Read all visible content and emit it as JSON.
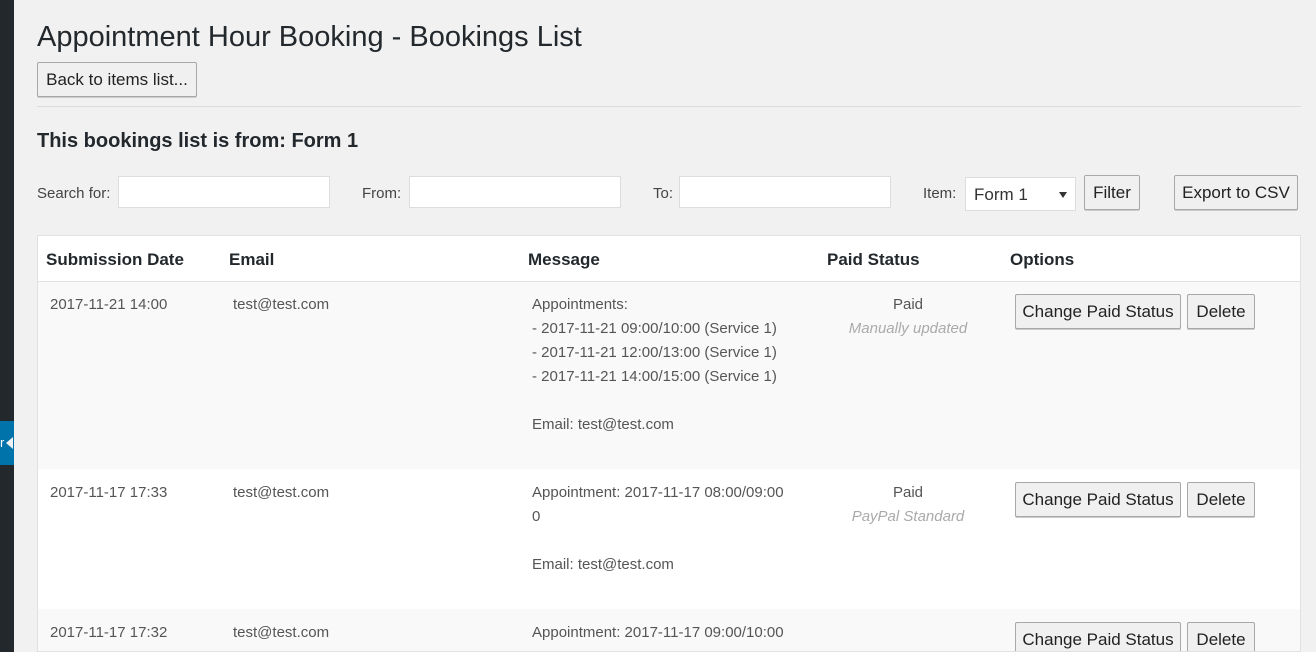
{
  "page": {
    "title": "Appointment Hour Booking - Bookings List",
    "back_label": "Back to items list...",
    "list_from": "This bookings list is from: Form 1",
    "sidebar_collapse_text": "r"
  },
  "filters": {
    "search_label": "Search for:",
    "search_value": "",
    "from_label": "From:",
    "from_value": "",
    "to_label": "To:",
    "to_value": "",
    "item_label": "Item:",
    "item_selected": "Form 1",
    "filter_label": "Filter",
    "export_label": "Export to CSV"
  },
  "table": {
    "headers": {
      "date": "Submission Date",
      "email": "Email",
      "message": "Message",
      "paid": "Paid Status",
      "options": "Options"
    },
    "rows": [
      {
        "date": "2017-11-21 14:00",
        "email": "test@test.com",
        "message": [
          "Appointments:",
          "- 2017-11-21 09:00/10:00 (Service 1)",
          "- 2017-11-21 12:00/13:00 (Service 1)",
          "- 2017-11-21 14:00/15:00 (Service 1)",
          "",
          "Email: test@test.com"
        ],
        "paid_status": "Paid",
        "paid_note": "Manually updated",
        "change_label": "Change Paid Status",
        "delete_label": "Delete"
      },
      {
        "date": "2017-11-17 17:33",
        "email": "test@test.com",
        "message": [
          "Appointment: 2017-11-17 08:00/09:00",
          "0",
          "",
          "Email: test@test.com"
        ],
        "paid_status": "Paid",
        "paid_note": "PayPal Standard",
        "change_label": "Change Paid Status",
        "delete_label": "Delete"
      },
      {
        "date": "2017-11-17 17:32",
        "email": "test@test.com",
        "message": [
          "Appointment: 2017-11-17 09:00/10:00"
        ],
        "paid_status": "",
        "paid_note": "",
        "change_label": "Change Paid Status",
        "delete_label": "Delete"
      }
    ]
  }
}
